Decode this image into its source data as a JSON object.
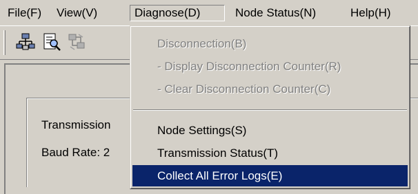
{
  "menubar": {
    "items": [
      {
        "label": "File(F)"
      },
      {
        "label": "View(V)"
      },
      {
        "label": "Diagnose(D)"
      },
      {
        "label": "Node Status(N)"
      },
      {
        "label": "Help(H)"
      }
    ]
  },
  "toolbar": {
    "buttons": [
      {
        "icon": "network-node-icon",
        "enabled": true
      },
      {
        "icon": "document-search-icon",
        "enabled": true
      },
      {
        "icon": "connect-icon",
        "enabled": false
      }
    ]
  },
  "content": {
    "transmission_label": "Transmission",
    "baud_rate_label": "Baud Rate:  2"
  },
  "diagnose_menu": {
    "items": [
      {
        "label": "Disconnection(B)",
        "enabled": false
      },
      {
        "label": "- Display Disconnection Counter(R)",
        "enabled": false
      },
      {
        "label": "- Clear Disconnection Counter(C)",
        "enabled": false
      },
      {
        "label": "Node Settings(S)",
        "enabled": true
      },
      {
        "label": "Transmission Status(T)",
        "enabled": true
      },
      {
        "label": "Collect All Error Logs(E)",
        "enabled": true,
        "highlighted": true
      }
    ]
  },
  "colors": {
    "face": "#d4d0c8",
    "highlight": "#0a246a",
    "disabled_text": "#808080"
  }
}
